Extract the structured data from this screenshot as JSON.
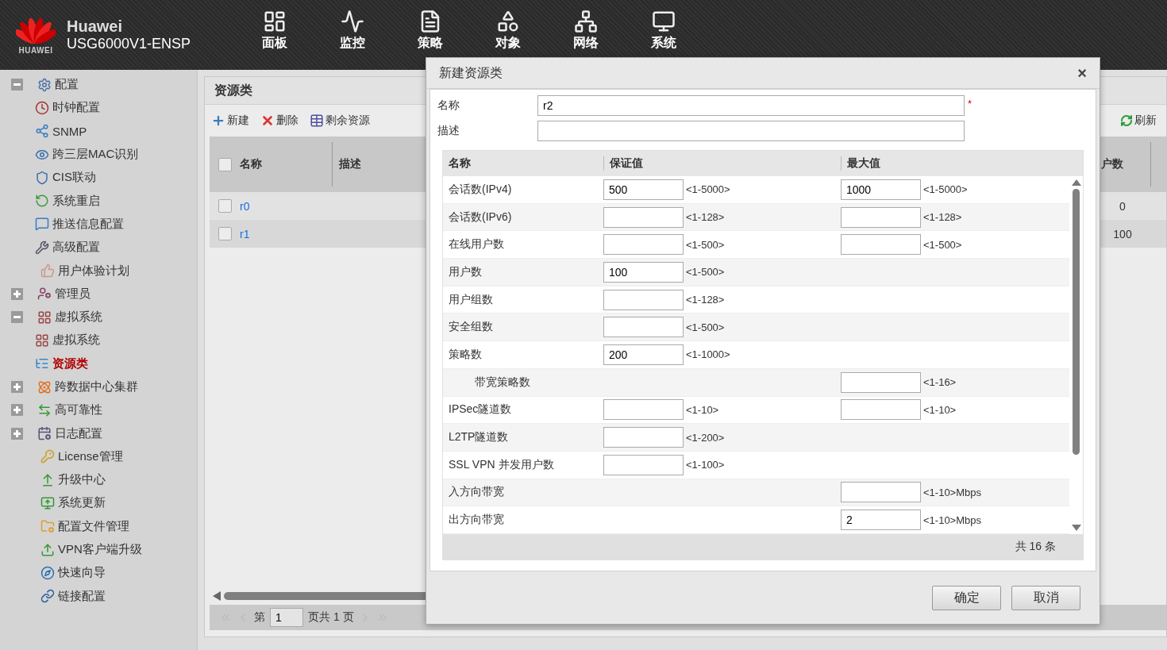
{
  "header": {
    "brand": "Huawei",
    "model": "USG6000V1-ENSP",
    "logo_text": "HUAWEI",
    "nav": [
      {
        "label": "面板"
      },
      {
        "label": "监控"
      },
      {
        "label": "策略"
      },
      {
        "label": "对象"
      },
      {
        "label": "网络"
      },
      {
        "label": "系统"
      }
    ]
  },
  "sidebar": {
    "tree": [
      {
        "label": "配置",
        "expanded": true,
        "selected": false,
        "children": [
          {
            "label": "时钟配置",
            "selected": false
          },
          {
            "label": "SNMP",
            "selected": false
          },
          {
            "label": "跨三层MAC识别",
            "selected": false
          },
          {
            "label": "CIS联动",
            "selected": false
          },
          {
            "label": "系统重启",
            "selected": false
          },
          {
            "label": "推送信息配置",
            "selected": false
          },
          {
            "label": "高级配置",
            "selected": false
          }
        ]
      },
      {
        "label": "用户体验计划",
        "selected": false
      },
      {
        "label": "管理员",
        "expanded": false,
        "selected": false
      },
      {
        "label": "虚拟系统",
        "expanded": true,
        "selected": false,
        "children": [
          {
            "label": "虚拟系统",
            "selected": false
          },
          {
            "label": "资源类",
            "selected": true
          }
        ]
      },
      {
        "label": "跨数据中心集群",
        "expanded": false,
        "selected": false
      },
      {
        "label": "高可靠性",
        "expanded": false,
        "selected": false
      },
      {
        "label": "日志配置",
        "expanded": false,
        "selected": false
      },
      {
        "label": "License管理",
        "selected": false
      },
      {
        "label": "升级中心",
        "selected": false
      },
      {
        "label": "系统更新",
        "selected": false
      },
      {
        "label": "配置文件管理",
        "selected": false
      },
      {
        "label": "VPN客户端升级",
        "selected": false
      },
      {
        "label": "快速向导",
        "selected": false
      },
      {
        "label": "链接配置",
        "selected": false
      }
    ]
  },
  "panel": {
    "title": "资源类",
    "toolbar": [
      {
        "kind": "add",
        "label": "新建"
      },
      {
        "kind": "delete",
        "label": "删除"
      },
      {
        "kind": "resources",
        "label": "剩余资源"
      }
    ],
    "refresh": "刷新",
    "table": {
      "columns": [
        "名称",
        "描述",
        "户数"
      ],
      "header_checked": false,
      "rows": [
        {
          "name": "r0",
          "users": "0",
          "checked": false
        },
        {
          "name": "r1",
          "users": "100",
          "checked": false
        }
      ]
    },
    "pager": {
      "before": "第",
      "page": "1",
      "after": "页共 1 页"
    }
  },
  "dialog": {
    "title": "新建资源类",
    "close": "×",
    "fields": [
      {
        "label": "名称",
        "value": "r2",
        "required_mark": "*"
      },
      {
        "label": "描述"
      }
    ],
    "grid": {
      "columns": [
        "名称",
        "保证值",
        "最大值"
      ],
      "rows": [
        {
          "name": "会话数(IPv4)",
          "guarantee": {
            "value": "500",
            "range": "<1-5000>"
          },
          "max": {
            "value": "1000",
            "range": "<1-5000>"
          }
        },
        {
          "name": "会话数(IPv6)",
          "guarantee": {
            "range": "<1-128>"
          },
          "max": {
            "range": "<1-128>"
          }
        },
        {
          "name": "在线用户数",
          "guarantee": {
            "range": "<1-500>"
          },
          "max": {
            "range": "<1-500>"
          }
        },
        {
          "name": "用户数",
          "guarantee": {
            "value": "100",
            "range": "<1-500>"
          }
        },
        {
          "name": "用户组数",
          "guarantee": {
            "range": "<1-128>"
          }
        },
        {
          "name": "安全组数",
          "guarantee": {
            "range": "<1-500>"
          }
        },
        {
          "name": "策略数",
          "guarantee": {
            "value": "200",
            "range": "<1-1000>"
          },
          "children": [
            {
              "name": "带宽策略数",
              "max": {
                "range": "<1-16>"
              }
            }
          ]
        },
        {
          "name": "IPSec隧道数",
          "guarantee": {
            "range": "<1-10>"
          },
          "max": {
            "range": "<1-10>"
          }
        },
        {
          "name": "L2TP隧道数",
          "guarantee": {
            "range": "<1-200>"
          }
        },
        {
          "name": "SSL VPN 并发用户数",
          "guarantee": {
            "range": "<1-100>"
          }
        },
        {
          "name": "入方向带宽",
          "max": {
            "range": "<1-10>Mbps"
          }
        },
        {
          "name": "出方向带宽",
          "max": {
            "value": "2",
            "range": "<1-10>Mbps"
          }
        }
      ],
      "footer": "共 16 条"
    },
    "buttons": [
      "确定",
      "取消"
    ]
  }
}
